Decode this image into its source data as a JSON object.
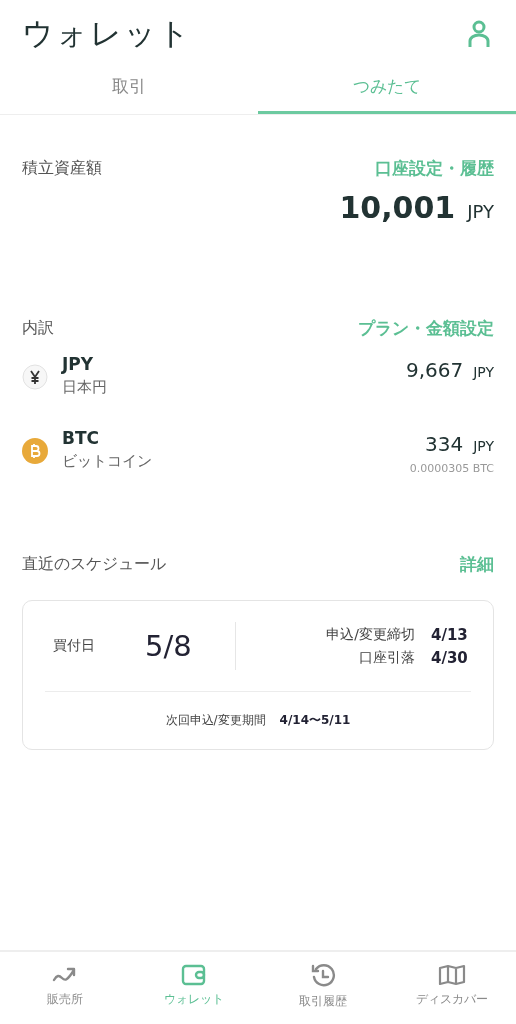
{
  "header": {
    "title": "ウォレット"
  },
  "tabs": [
    {
      "label": "取引",
      "selected": false
    },
    {
      "label": "つみたて",
      "selected": true
    }
  ],
  "total": {
    "label": "積立資産額",
    "link": "口座設定・履歴",
    "amount": "10,001",
    "unit": "JPY"
  },
  "breakdown": {
    "label": "内訳",
    "link": "プラン・金額設定",
    "assets": [
      {
        "kind": "yen",
        "symbol": "JPY",
        "name": "日本円",
        "amount": "9,667",
        "unit": "JPY"
      },
      {
        "kind": "btc",
        "symbol": "BTC",
        "name": "ビットコイン",
        "amount": "334",
        "unit": "JPY",
        "sub": "0.0000305 BTC"
      }
    ]
  },
  "schedule": {
    "label": "直近のスケジュール",
    "link": "詳細",
    "buy_label": "買付日",
    "buy_date": "5/8",
    "rows": [
      {
        "label": "申込/変更締切",
        "value": "4/13"
      },
      {
        "label": "口座引落",
        "value": "4/30"
      }
    ],
    "next_label": "次回申込/変更期間",
    "next_value": "4/14〜5/11"
  },
  "nav": [
    {
      "kind": "chart",
      "label": "販売所",
      "selected": false
    },
    {
      "kind": "wallet",
      "label": "ウォレット",
      "selected": true
    },
    {
      "kind": "history",
      "label": "取引履歴",
      "selected": false
    },
    {
      "kind": "map",
      "label": "ディスカバー",
      "selected": false
    }
  ]
}
